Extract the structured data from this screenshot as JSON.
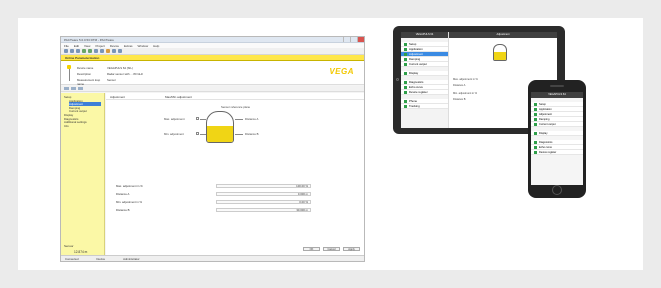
{
  "desktop": {
    "title": "PACTware 5.0.0.53 DTM - PACTware",
    "menu": [
      "File",
      "Edit",
      "View",
      "Project",
      "Device",
      "Extras",
      "Window",
      "Help"
    ],
    "tab_label": "Online Parameterization",
    "device_info": [
      {
        "label": "Device name",
        "value": "VEGAPULS 64 (SIL)"
      },
      {
        "label": "Description",
        "value": "Radar sensor with ... 80 GHz"
      },
      {
        "label": "Measurement loop name",
        "value": "Sensor"
      }
    ],
    "brand": "VEGA",
    "tree": [
      "Setup",
      "Application",
      "Adjustment",
      "Damping",
      "Current output",
      "Display",
      "Diagnostics",
      "Additional settings",
      "Info"
    ],
    "tree_selected_index": 2,
    "content_header": {
      "section": "Adjustment",
      "description": "Max/Min adjustment"
    },
    "diagram": {
      "max_label": "Max. adjustment",
      "min_label": "Min. adjustment",
      "top_label": "Sensor reference plane",
      "distance_a": "Distance A",
      "distance_b": "Distance B",
      "fill_level": 0.55
    },
    "rows": [
      {
        "label": "Max. adjustment in %",
        "value": "100.00 %"
      },
      {
        "label": "Distance A",
        "value": "0.000 m"
      },
      {
        "label": "Min. adjustment in %",
        "value": "0.00 %"
      },
      {
        "label": "Distance B",
        "value": "30.000 m"
      }
    ],
    "level_label": "Sensor",
    "level_value": "12.874 m",
    "buttons": [
      "OK",
      "Cancel",
      "Apply"
    ],
    "status": [
      "Connected",
      "Device",
      "Administrator"
    ]
  },
  "tablet": {
    "left_header": "VEGAPULS 64",
    "right_header": "Adjustment",
    "menu": [
      "Setup",
      "Application",
      "Adjustment",
      "Damping",
      "Current output"
    ],
    "menu_selected_index": 2,
    "menu2": [
      "Display"
    ],
    "menu3": [
      "Diagnostics",
      "Echo curve",
      "Device register"
    ],
    "menu4": [
      "Phone",
      "Tracking"
    ],
    "rows": [
      "Max. adjustment in %",
      "Distance A",
      "Min. adjustment in %",
      "Distance B"
    ]
  },
  "phone": {
    "header": "VEGAPULS 64",
    "menu": [
      "Setup",
      "Application",
      "Adjustment",
      "Damping",
      "Current output"
    ],
    "menu2": [
      "Display"
    ],
    "menu3": [
      "Diagnostics",
      "Echo curve",
      "Device register"
    ]
  }
}
